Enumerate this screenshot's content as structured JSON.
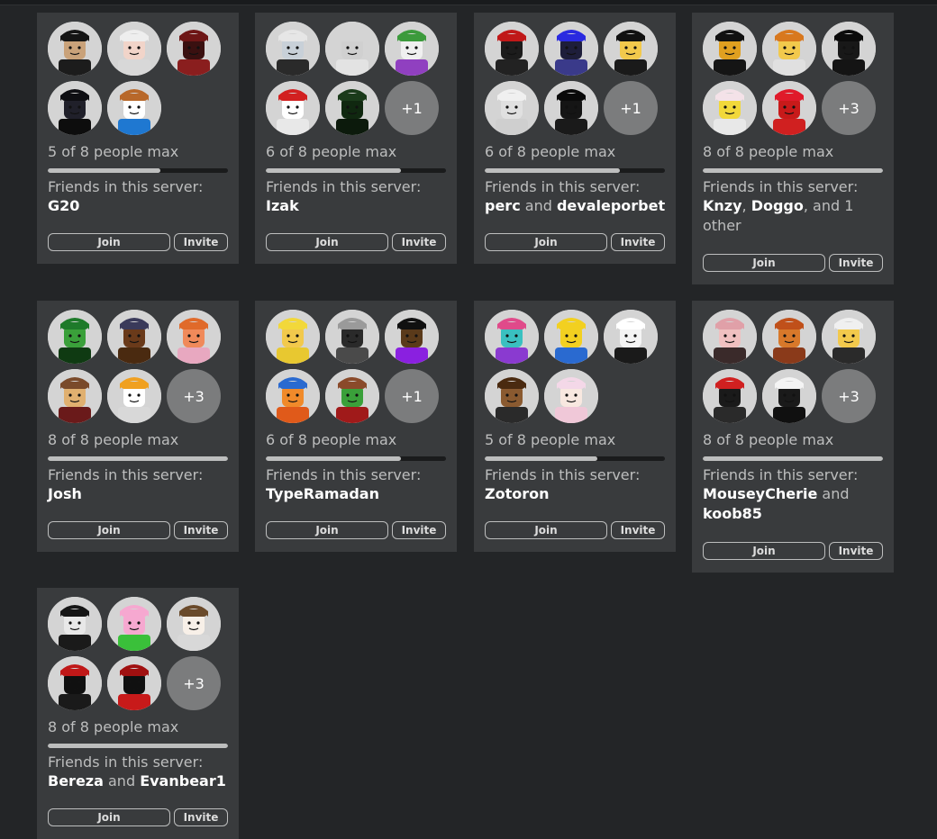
{
  "servers": [
    {
      "avatars": [
        {
          "name": "avatar-black-hair",
          "hair": "#151515",
          "skin": "#c9a27a",
          "shirt": "#1c1c1c"
        },
        {
          "name": "avatar-white-hair",
          "hair": "#eeeeee",
          "skin": "#f1d4c9",
          "shirt": "#d8d8d8"
        },
        {
          "name": "avatar-red-wolf",
          "hair": "#6e1616",
          "skin": "#3a1010",
          "shirt": "#8a1e1e"
        },
        {
          "name": "avatar-black-spiky",
          "hair": "#0e0e12",
          "skin": "#20202a",
          "shirt": "#0d0d0d"
        },
        {
          "name": "avatar-bacon-hair",
          "hair": "#b8682a",
          "skin": "#ffffff",
          "shirt": "#1f78d1"
        }
      ],
      "overflow": "",
      "players_text": "5 of 8 people max",
      "fill": 0.625,
      "friends_label": "Friends in this server:",
      "friends": [
        {
          "t": "G20",
          "b": true
        }
      ],
      "join_label": "Join",
      "invite_label": "Invite"
    },
    {
      "avatars": [
        {
          "name": "avatar-robot-helmet",
          "hair": "#e6e6e6",
          "skin": "#c8d0d8",
          "shirt": "#2a2a2a"
        },
        {
          "name": "avatar-blank-head",
          "hair": "#d4d4d4",
          "skin": "#d0d0d0",
          "shirt": "#e3e3e3"
        },
        {
          "name": "avatar-rainbow-wings",
          "hair": "#3c9a3c",
          "skin": "#f0f0f0",
          "shirt": "#9040c0"
        },
        {
          "name": "avatar-santa-snowman",
          "hair": "#d22020",
          "skin": "#ffffff",
          "shirt": "#e8e8e8"
        },
        {
          "name": "avatar-dark-dragon",
          "hair": "#1b3b1b",
          "skin": "#102810",
          "shirt": "#0c1a0c"
        }
      ],
      "overflow": "+1",
      "players_text": "6 of 8 people max",
      "fill": 0.75,
      "friends_label": "Friends in this server:",
      "friends": [
        {
          "t": "Izak",
          "b": true
        }
      ],
      "join_label": "Join",
      "invite_label": "Invite"
    },
    {
      "avatars": [
        {
          "name": "avatar-red-spiky",
          "hair": "#c01818",
          "skin": "#1c1c1c",
          "shirt": "#222222"
        },
        {
          "name": "avatar-blue-armor",
          "hair": "#2a2ae0",
          "skin": "#1e1e3a",
          "shirt": "#3a3a8a"
        },
        {
          "name": "avatar-smile-black-hair",
          "hair": "#111111",
          "skin": "#f2c94c",
          "shirt": "#1a1a1a"
        },
        {
          "name": "avatar-white-tank",
          "hair": "#f0f0f0",
          "skin": "#e0e0e0",
          "shirt": "#cfcfcf"
        },
        {
          "name": "avatar-black-hoodie",
          "hair": "#0a0a0a",
          "skin": "#151515",
          "shirt": "#1a1a1a"
        }
      ],
      "overflow": "+1",
      "players_text": "6 of 8 people max",
      "fill": 0.75,
      "friends_label": "Friends in this server:",
      "friends": [
        {
          "t": "perc",
          "b": true
        },
        {
          "t": " and ",
          "b": false
        },
        {
          "t": "devaleporbet",
          "b": true
        }
      ],
      "join_label": "Join",
      "invite_label": "Invite"
    },
    {
      "avatars": [
        {
          "name": "avatar-gold-coin",
          "hair": "#111111",
          "skin": "#e0a020",
          "shirt": "#151515"
        },
        {
          "name": "avatar-orange-hair",
          "hair": "#d8781e",
          "skin": "#f2c94c",
          "shirt": "#e0e0e0"
        },
        {
          "name": "avatar-black-emo",
          "hair": "#0c0c0c",
          "skin": "#181818",
          "shirt": "#141414"
        },
        {
          "name": "avatar-yellow-bunny",
          "hair": "#f4e2e8",
          "skin": "#f2d83a",
          "shirt": "#e8e8e8"
        },
        {
          "name": "avatar-red-devil",
          "hair": "#e01a2a",
          "skin": "#c81a1a",
          "shirt": "#d02020"
        }
      ],
      "overflow": "+3",
      "players_text": "8 of 8 people max",
      "fill": 1.0,
      "friends_label": "Friends in this server:",
      "friends": [
        {
          "t": "Knzy",
          "b": true
        },
        {
          "t": ", ",
          "b": false
        },
        {
          "t": "Doggo",
          "b": true
        },
        {
          "t": ", and 1 other",
          "b": false
        }
      ],
      "join_label": "Join",
      "invite_label": "Invite"
    },
    {
      "avatars": [
        {
          "name": "avatar-green-hood",
          "hair": "#1e7a2a",
          "skin": "#3aa03a",
          "shirt": "#0f3a12"
        },
        {
          "name": "avatar-cowboy-hat",
          "hair": "#3a3a5a",
          "skin": "#6a3a1a",
          "shirt": "#4a2a10"
        },
        {
          "name": "avatar-orange-cat",
          "hair": "#e06a2a",
          "skin": "#f08a5a",
          "shirt": "#e8a8c0"
        },
        {
          "name": "avatar-brown-beanie",
          "hair": "#7a4a2a",
          "skin": "#e0b070",
          "shirt": "#6a1a1a"
        },
        {
          "name": "avatar-top-hat",
          "hair": "#f0a020",
          "skin": "#ffffff",
          "shirt": "#d8d8d8"
        }
      ],
      "overflow": "+3",
      "players_text": "8 of 8 people max",
      "fill": 1.0,
      "friends_label": "Friends in this server:",
      "friends": [
        {
          "t": "Josh",
          "b": true
        }
      ],
      "join_label": "Join",
      "invite_label": "Invite"
    },
    {
      "avatars": [
        {
          "name": "avatar-yellow-jester",
          "hair": "#f2d83a",
          "skin": "#f2c94c",
          "shirt": "#e8c830"
        },
        {
          "name": "avatar-sword-knight",
          "hair": "#9a9a9a",
          "skin": "#2a2a2a",
          "shirt": "#4a4a4a"
        },
        {
          "name": "avatar-purple-visor",
          "hair": "#101010",
          "skin": "#5a3a1a",
          "shirt": "#8a20e0"
        },
        {
          "name": "avatar-orange-beanie",
          "hair": "#2a6ad0",
          "skin": "#f08a2a",
          "shirt": "#e05a1a"
        },
        {
          "name": "avatar-antler-red",
          "hair": "#8a4a2a",
          "skin": "#3aa03a",
          "shirt": "#a01a1a"
        }
      ],
      "overflow": "+1",
      "players_text": "6 of 8 people max",
      "fill": 0.75,
      "friends_label": "Friends in this server:",
      "friends": [
        {
          "t": "TypeRamadan",
          "b": true
        }
      ],
      "join_label": "Join",
      "invite_label": "Invite"
    },
    {
      "avatars": [
        {
          "name": "avatar-pink-cap",
          "hair": "#e04a8a",
          "skin": "#3ac0c0",
          "shirt": "#8a3ad0"
        },
        {
          "name": "avatar-noob-smile",
          "hair": "#f2d020",
          "skin": "#f2d020",
          "shirt": "#2a6ad0"
        },
        {
          "name": "avatar-white-bear",
          "hair": "#ffffff",
          "skin": "#f4f4f4",
          "shirt": "#1a1a1a"
        },
        {
          "name": "avatar-brown-dreads",
          "hair": "#4a2a10",
          "skin": "#8a5a30",
          "shirt": "#2a2a2a"
        },
        {
          "name": "avatar-pink-girl",
          "hair": "#f4d8e8",
          "skin": "#f8e8e0",
          "shirt": "#f0c8d8"
        }
      ],
      "overflow": "",
      "players_text": "5 of 8 people max",
      "fill": 0.625,
      "friends_label": "Friends in this server:",
      "friends": [
        {
          "t": "Zotoron",
          "b": true
        }
      ],
      "join_label": "Join",
      "invite_label": "Invite"
    },
    {
      "avatars": [
        {
          "name": "avatar-pink-bunny",
          "hair": "#e0a0a8",
          "skin": "#f0c0c0",
          "shirt": "#3a2a2a"
        },
        {
          "name": "avatar-orange-bear",
          "hair": "#c0501a",
          "skin": "#d8782a",
          "shirt": "#8a3a1a"
        },
        {
          "name": "avatar-viking-helmet",
          "hair": "#f0f0f0",
          "skin": "#f2c94c",
          "shirt": "#2a2a2a"
        },
        {
          "name": "avatar-red-headphones",
          "hair": "#d02020",
          "skin": "#1a1a1a",
          "shirt": "#2a2a2a"
        },
        {
          "name": "avatar-white-cap",
          "hair": "#f4f4f4",
          "skin": "#1a1a1a",
          "shirt": "#101010"
        }
      ],
      "overflow": "+3",
      "players_text": "8 of 8 people max",
      "fill": 1.0,
      "friends_label": "Friends in this server:",
      "friends": [
        {
          "t": "MouseyCherie",
          "b": true
        },
        {
          "t": " and ",
          "b": false
        },
        {
          "t": "koob85",
          "b": true
        }
      ],
      "join_label": "Join",
      "invite_label": "Invite"
    },
    {
      "avatars": [
        {
          "name": "avatar-skull-hood",
          "hair": "#151515",
          "skin": "#e8e8e8",
          "shirt": "#1a1a1a"
        },
        {
          "name": "avatar-pink-star",
          "hair": "#f6a8d0",
          "skin": "#f6a8d0",
          "shirt": "#3ac03a"
        },
        {
          "name": "avatar-brown-witch",
          "hair": "#6a4a2a",
          "skin": "#f8f0e8",
          "shirt": "#d8d8d8"
        },
        {
          "name": "avatar-red-black-hair",
          "hair": "#c01818",
          "skin": "#101010",
          "shirt": "#1a1a1a"
        },
        {
          "name": "avatar-red-plaid",
          "hair": "#a01010",
          "skin": "#101010",
          "shirt": "#c81a1a"
        }
      ],
      "overflow": "+3",
      "players_text": "8 of 8 people max",
      "fill": 1.0,
      "friends_label": "Friends in this server:",
      "friends": [
        {
          "t": "Bereza",
          "b": true
        },
        {
          "t": " and ",
          "b": false
        },
        {
          "t": "Evanbear1",
          "b": true
        }
      ],
      "join_label": "Join",
      "invite_label": "Invite"
    }
  ]
}
